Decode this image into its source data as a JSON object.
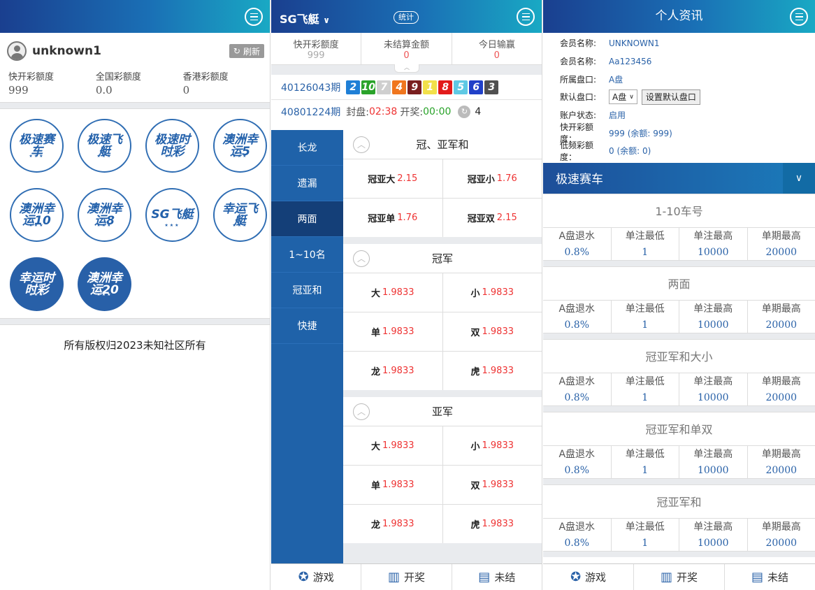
{
  "p1": {
    "username": "unknown1",
    "refresh_label": "刷新",
    "quotas": [
      {
        "label": "快开彩额度",
        "value": "999"
      },
      {
        "label": "全国彩额度",
        "value": "0.0"
      },
      {
        "label": "香港彩额度",
        "value": "0"
      }
    ],
    "games": [
      {
        "name": "极速赛车",
        "filled": false
      },
      {
        "name": "极速飞艇",
        "filled": false
      },
      {
        "name": "极速时时彩",
        "filled": false
      },
      {
        "name": "澳洲幸运5",
        "filled": false
      },
      {
        "name": "澳洲幸运10",
        "filled": false
      },
      {
        "name": "澳洲幸运8",
        "filled": false
      },
      {
        "name": "SG飞艇",
        "filled": false
      },
      {
        "name": "幸运飞艇",
        "filled": false
      },
      {
        "name": "幸运时时彩",
        "filled": true
      },
      {
        "name": "澳洲幸运20",
        "filled": true
      }
    ],
    "copyright": "所有版权归2023未知社区所有"
  },
  "p2": {
    "title": "SG飞艇",
    "title_caret": "∨",
    "stat_label": "统计",
    "summary": [
      {
        "label": "快开彩额度",
        "value": "999",
        "red": false
      },
      {
        "label": "未结算金额",
        "value": "0",
        "red": true
      },
      {
        "label": "今日输赢",
        "value": "0",
        "red": true
      }
    ],
    "last_period": "40126043期",
    "balls": [
      {
        "n": "2",
        "color": "#1f7fd6"
      },
      {
        "n": "10",
        "color": "#2aa32a"
      },
      {
        "n": "7",
        "color": "#cfcfcf"
      },
      {
        "n": "4",
        "color": "#f0761e"
      },
      {
        "n": "9",
        "color": "#7a1f1f"
      },
      {
        "n": "1",
        "color": "#f2e04a"
      },
      {
        "n": "8",
        "color": "#e21b1b"
      },
      {
        "n": "5",
        "color": "#5fc9e4"
      },
      {
        "n": "6",
        "color": "#2040c8"
      },
      {
        "n": "3",
        "color": "#505050"
      }
    ],
    "cur_period": "40801224期",
    "close_label": "封盘:",
    "close_time": "02:38",
    "draw_label": "开奖:",
    "draw_time": "00:00",
    "countdown": "4",
    "nav": [
      {
        "label": "长龙",
        "active": false
      },
      {
        "label": "遗漏",
        "active": false
      },
      {
        "label": "两面",
        "active": true
      },
      {
        "label": "1~10名",
        "active": false
      },
      {
        "label": "冠亚和",
        "active": false
      },
      {
        "label": "快捷",
        "active": false
      }
    ],
    "blocks": [
      {
        "title": "冠、亚军和",
        "rows": [
          [
            {
              "k": "冠亚大",
              "v": "2.15"
            },
            {
              "k": "冠亚小",
              "v": "1.76"
            }
          ],
          [
            {
              "k": "冠亚单",
              "v": "1.76"
            },
            {
              "k": "冠亚双",
              "v": "2.15"
            }
          ]
        ]
      },
      {
        "title": "冠军",
        "rows": [
          [
            {
              "k": "大",
              "v": "1.9833"
            },
            {
              "k": "小",
              "v": "1.9833"
            }
          ],
          [
            {
              "k": "单",
              "v": "1.9833"
            },
            {
              "k": "双",
              "v": "1.9833"
            }
          ],
          [
            {
              "k": "龙",
              "v": "1.9833"
            },
            {
              "k": "虎",
              "v": "1.9833"
            }
          ]
        ]
      },
      {
        "title": "亚军",
        "rows": [
          [
            {
              "k": "大",
              "v": "1.9833"
            },
            {
              "k": "小",
              "v": "1.9833"
            }
          ],
          [
            {
              "k": "单",
              "v": "1.9833"
            },
            {
              "k": "双",
              "v": "1.9833"
            }
          ],
          [
            {
              "k": "龙",
              "v": "1.9833"
            },
            {
              "k": "虎",
              "v": "1.9833"
            }
          ]
        ]
      }
    ],
    "footer": [
      {
        "label": "游戏",
        "icon": "lifebuoy-icon"
      },
      {
        "label": "开奖",
        "icon": "bar-chart-icon"
      },
      {
        "label": "未结",
        "icon": "document-icon"
      }
    ]
  },
  "p3": {
    "title": "个人资讯",
    "info": [
      {
        "label": "会员名称:",
        "value": "UNKNOWN1"
      },
      {
        "label": "会员名称:",
        "value": "Aa123456"
      },
      {
        "label": "所属盘口:",
        "value": "A盘"
      }
    ],
    "default_label": "默认盘口:",
    "default_select": "A盘",
    "default_btn": "设置默认盘口",
    "status_label": "账户状态:",
    "status_value": "启用",
    "quota_label": "快开彩额度：",
    "quota_value": "999 (余额: 999)",
    "low_label": "低频彩额度：",
    "low_value": "0 (余额: 0)",
    "section": "极速赛车",
    "section_chevron": "∨",
    "col_headers": [
      "A盘退水",
      "单注最低",
      "单注最高",
      "单期最高"
    ],
    "limits": [
      {
        "title": "1-10车号",
        "values": [
          "0.8%",
          "1",
          "10000",
          "20000"
        ]
      },
      {
        "title": "两面",
        "values": [
          "0.8%",
          "1",
          "10000",
          "20000"
        ]
      },
      {
        "title": "冠亚军和大小",
        "values": [
          "0.8%",
          "1",
          "10000",
          "20000"
        ]
      },
      {
        "title": "冠亚军和单双",
        "values": [
          "0.8%",
          "1",
          "10000",
          "20000"
        ]
      },
      {
        "title": "冠亚军和",
        "values": [
          "0.8%",
          "1",
          "10000",
          "20000"
        ]
      }
    ],
    "footer": [
      {
        "label": "游戏",
        "icon": "lifebuoy-icon"
      },
      {
        "label": "开奖",
        "icon": "bar-chart-icon"
      },
      {
        "label": "未结",
        "icon": "document-icon"
      }
    ]
  }
}
